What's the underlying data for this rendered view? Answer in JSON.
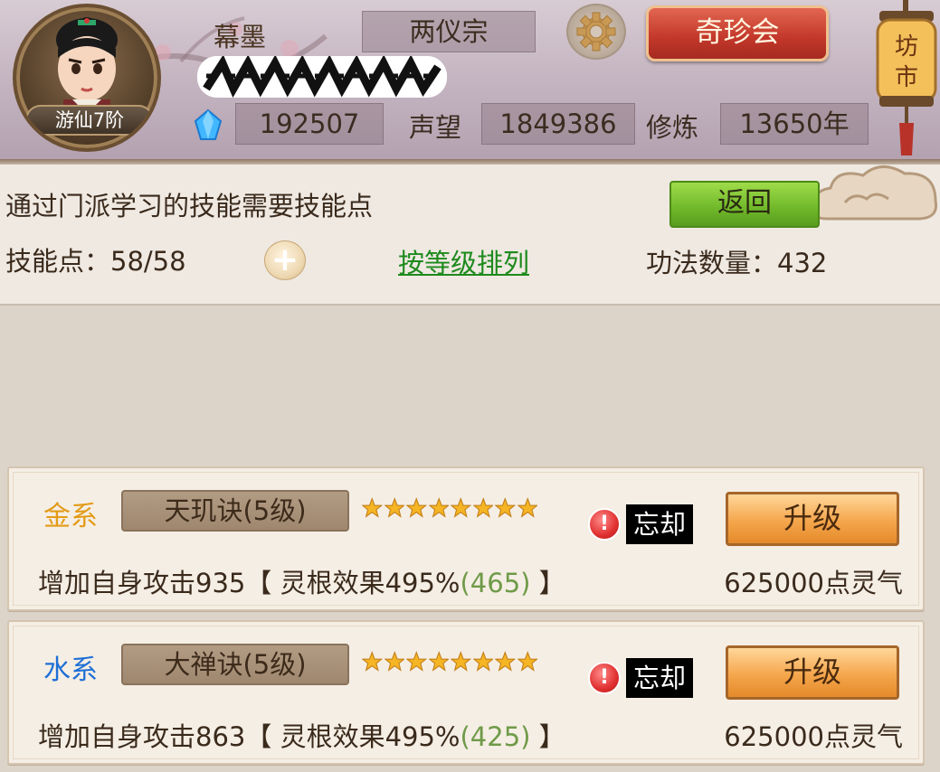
{
  "header": {
    "rank": "游仙7阶",
    "player_name": "幕墨",
    "sect": "两仪宗",
    "treasure_button": "奇珍会",
    "market_sign": "坊市",
    "spirit_stones": "192507",
    "fame_label": "声望",
    "fame_value": "1849386",
    "cultivation_label": "修炼",
    "cultivation_value": "13650年"
  },
  "info": {
    "description": "通过门派学习的技能需要技能点",
    "return_button": "返回",
    "skill_points_label": "技能点：58/58",
    "add_icon": "plus-icon",
    "sort_link": "按等级排列",
    "technique_count": "功法数量：432"
  },
  "skills": [
    {
      "element": "金系",
      "element_color": "#e39b16",
      "name": "天玑诀(5级)",
      "stars": 8,
      "warning_icon": "exclamation-icon",
      "forget_label": "忘却",
      "upgrade_button": "升级",
      "effect_prefix": "增加自身攻击935【 灵根效果495%",
      "effect_bonus": "(465)",
      "effect_suffix": " 】",
      "cost": "625000点灵气"
    },
    {
      "element": "水系",
      "element_color": "#1e6fd6",
      "name": "大禅诀(5级)",
      "stars": 8,
      "warning_icon": "exclamation-icon",
      "forget_label": "忘却",
      "upgrade_button": "升级",
      "effect_prefix": "增加自身攻击863【 灵根效果495%",
      "effect_bonus": "(425)",
      "effect_suffix": " 】",
      "cost": "625000点灵气"
    }
  ],
  "colors": {
    "return_green": "#6fb82a",
    "treasure_red": "#c2372a",
    "upgrade_orange": "#f5a64c",
    "sort_link_green": "#1d8a1d"
  }
}
